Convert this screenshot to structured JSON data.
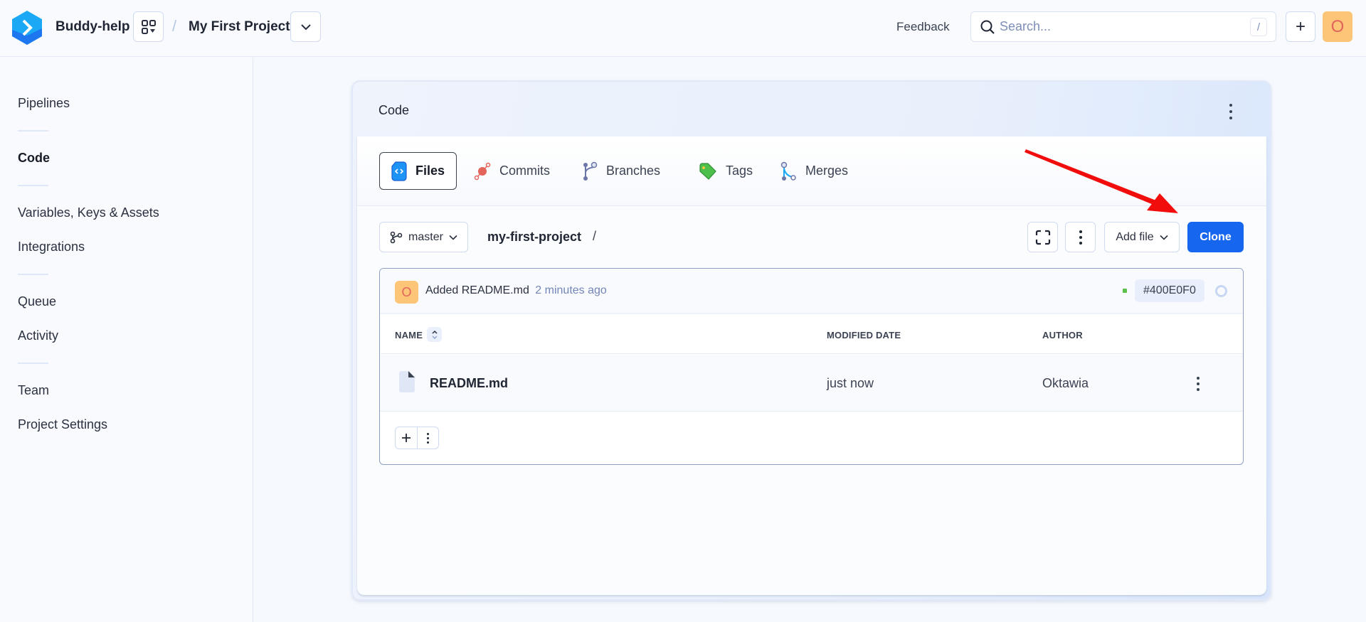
{
  "topbar": {
    "org_name": "Buddy-help",
    "breadcrumb_separator": "/",
    "project_name": "My First Project",
    "feedback_label": "Feedback",
    "search_placeholder": "Search...",
    "search_shortcut": "/",
    "add_label": "+",
    "user_initial": "O"
  },
  "sidebar": {
    "items": [
      {
        "label": "Pipelines"
      },
      {
        "label": "Code",
        "active": true
      },
      {
        "label": "Variables, Keys & Assets"
      },
      {
        "label": "Integrations"
      },
      {
        "label": "Queue"
      },
      {
        "label": "Activity"
      },
      {
        "label": "Team"
      },
      {
        "label": "Project Settings"
      }
    ]
  },
  "card": {
    "title": "Code",
    "tabs": [
      {
        "label": "Files",
        "icon": "file-code-icon",
        "active": true
      },
      {
        "label": "Commits",
        "icon": "commit-icon"
      },
      {
        "label": "Branches",
        "icon": "branch-icon"
      },
      {
        "label": "Tags",
        "icon": "tag-icon"
      },
      {
        "label": "Merges",
        "icon": "merge-icon"
      }
    ],
    "branch": "master",
    "repo_path": "my-first-project",
    "path_separator": "/",
    "add_file_label": "Add file",
    "clone_label": "Clone"
  },
  "commit": {
    "author_initial": "O",
    "message": "Added README.md",
    "time": "2 minutes ago",
    "hash": "#400E0F0",
    "status_color": "#5cc04a"
  },
  "table": {
    "columns": [
      "NAME",
      "MODIFIED DATE",
      "AUTHOR"
    ],
    "rows": [
      {
        "name": "README.md",
        "modified": "just now",
        "author": "Oktawia"
      }
    ]
  },
  "colors": {
    "accent": "#1766f0",
    "avatar_bg": "#fcc578",
    "avatar_fg": "#e2645b",
    "annotation_arrow": "#f20d0d"
  }
}
